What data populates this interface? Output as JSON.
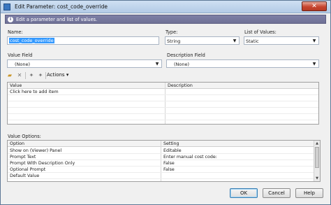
{
  "window": {
    "title": "Edit Parameter: cost_code_override",
    "close_glyph": "✕"
  },
  "banner": {
    "text": "Edit a parameter and list of values."
  },
  "form": {
    "name_label": "Name:",
    "name_value": "cost_code_override",
    "type_label": "Type:",
    "type_value": "String",
    "lov_label": "List of Values:",
    "lov_value": "Static",
    "value_field_label": "Value Field",
    "value_field_value": "(None)",
    "description_field_label": "Description Field",
    "description_field_value": "(None)"
  },
  "toolbar": {
    "actions_label": "Actions"
  },
  "values_grid": {
    "columns": [
      "Value",
      "Description"
    ],
    "placeholder_row": "Click here to add item"
  },
  "options": {
    "section_label": "Value Options:",
    "columns": [
      "Option",
      "Setting"
    ],
    "rows": [
      {
        "option": "Show on (Viewer) Panel",
        "setting": "Editable"
      },
      {
        "option": "Prompt Text",
        "setting": "Enter manual cost code:"
      },
      {
        "option": "Prompt With Description Only",
        "setting": "False"
      },
      {
        "option": "Optional Prompt",
        "setting": "False"
      },
      {
        "option": "Default Value",
        "setting": ""
      }
    ]
  },
  "buttons": {
    "ok": "OK",
    "cancel": "Cancel",
    "help": "Help"
  }
}
